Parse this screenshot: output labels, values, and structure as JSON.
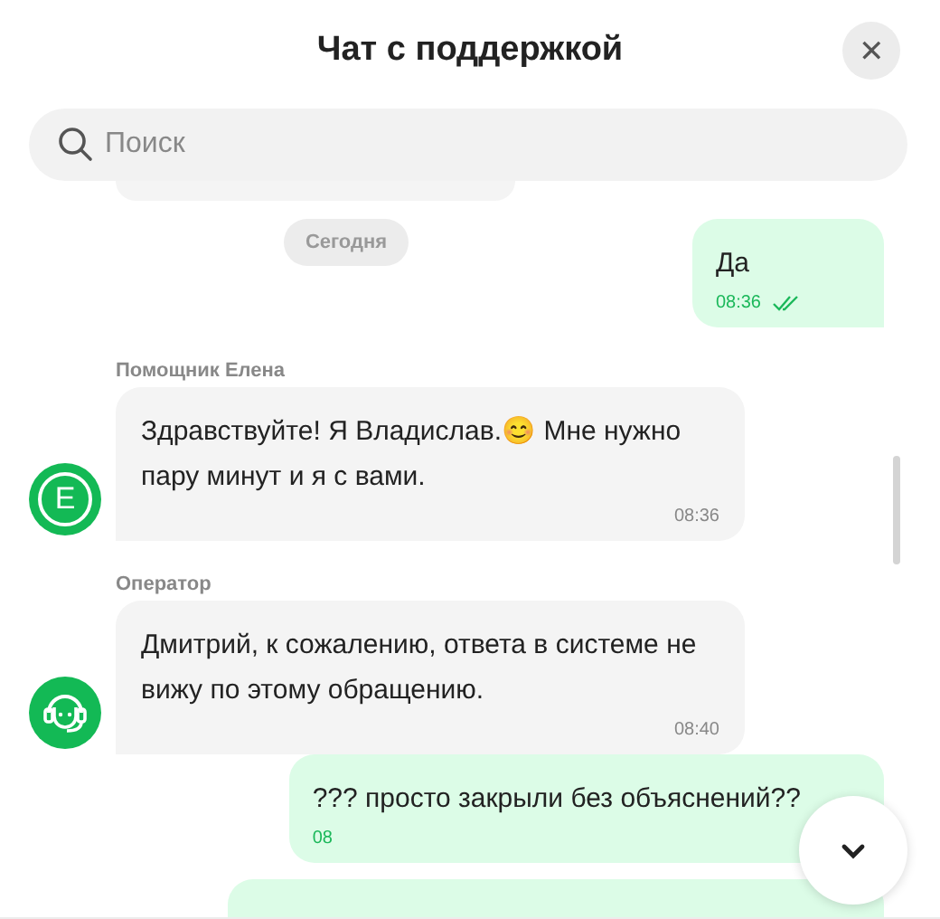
{
  "header": {
    "title": "Чат с поддержкой",
    "close": "✕"
  },
  "search": {
    "placeholder": "Поиск"
  },
  "messages": [
    {
      "kind": "partial_in"
    },
    {
      "kind": "date",
      "text": "Сегодня"
    },
    {
      "kind": "outgoing",
      "text": "Да",
      "time": "08:36",
      "read": true
    },
    {
      "kind": "incoming",
      "sender": "Помощник Елена",
      "avatar": {
        "kind": "letter",
        "text": "E"
      },
      "text": "Здравствуйте! Я Владислав.😊 Мне нужно пару минут и я с вами.",
      "time": "08:36"
    },
    {
      "kind": "incoming",
      "sender": "Оператор",
      "avatar": {
        "kind": "operator"
      },
      "text": "Дмитрий, к сожалению, ответа в системе не вижу по этому обращению.",
      "time": "08:40"
    },
    {
      "kind": "outgoing",
      "text": "??? просто закрыли без объяснений??",
      "time": "08",
      "read": false
    },
    {
      "kind": "partial_out"
    }
  ]
}
